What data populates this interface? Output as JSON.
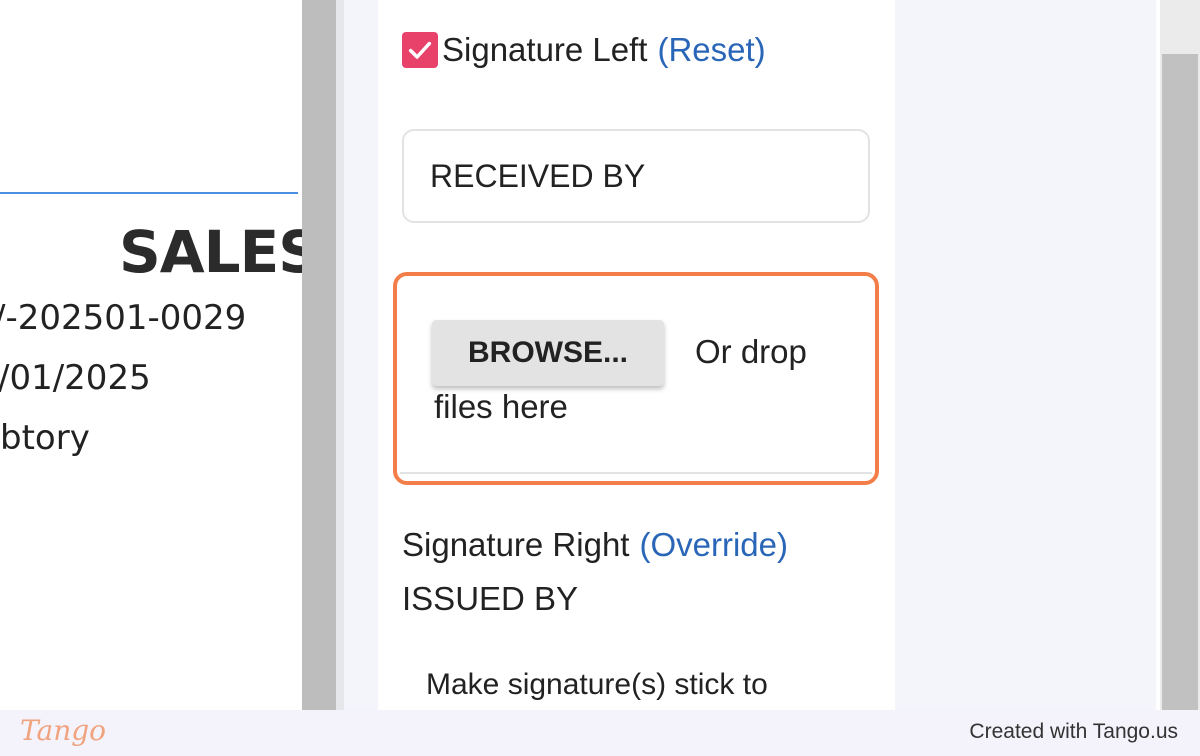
{
  "document_preview": {
    "title": "SALES",
    "lines": [
      "/-202501-0029",
      "/01/2025",
      "btory"
    ]
  },
  "signature_left": {
    "checked": true,
    "label": "Signature Left",
    "action_label": "(Reset)",
    "input_value": "RECEIVED BY"
  },
  "dropzone": {
    "browse_label": "BROWSE...",
    "drop_text_line1": "Or drop",
    "drop_text_line2": "files here",
    "highlight_color": "#f47e49"
  },
  "signature_right": {
    "label": "Signature Right",
    "action_label": "(Override)",
    "value": "ISSUED BY"
  },
  "stick_option": {
    "label": "Make signature(s) stick to"
  },
  "footer": {
    "logo": "Tango",
    "credit": "Created with Tango.us"
  },
  "colors": {
    "accent_checkbox": "#e8416a",
    "link": "#2a66b8",
    "doc_rule": "#4a90e2"
  },
  "icons": {
    "checkbox": "check-icon"
  }
}
